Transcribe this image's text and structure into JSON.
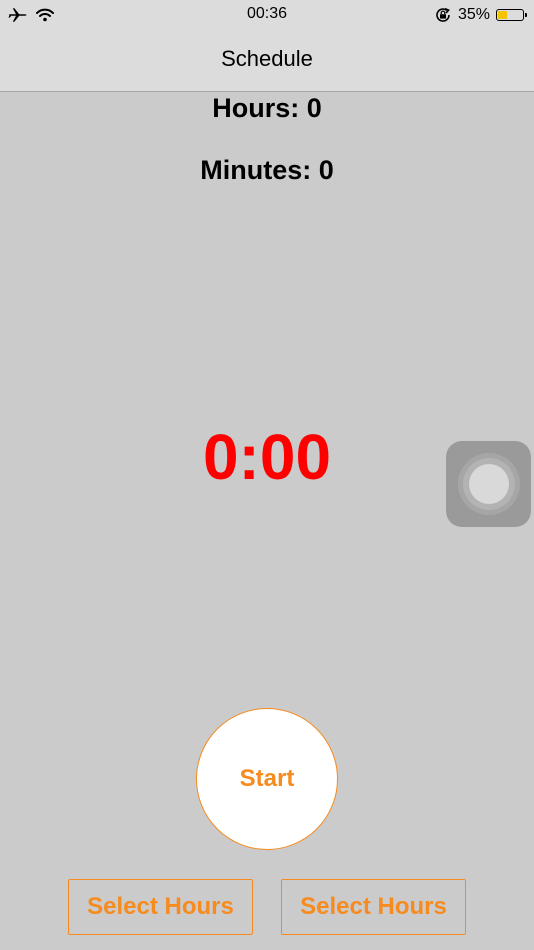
{
  "status_bar": {
    "time": "00:36",
    "battery_percent": "35%",
    "battery_level": 0.35,
    "icons": [
      "airplane-mode-icon",
      "wifi-icon",
      "orientation-lock-icon",
      "battery-icon"
    ]
  },
  "nav": {
    "title": "Schedule"
  },
  "schedule": {
    "hours_label": "Hours: 0",
    "minutes_label": "Minutes: 0",
    "countdown": "0:00",
    "countdown_color": "#fe0000"
  },
  "actions": {
    "start_label": "Start",
    "select_left_label": "Select Hours",
    "select_right_label": "Select Hours",
    "accent_color": "#f68b1f"
  },
  "overlay": {
    "icon": "assistive-touch-icon"
  }
}
